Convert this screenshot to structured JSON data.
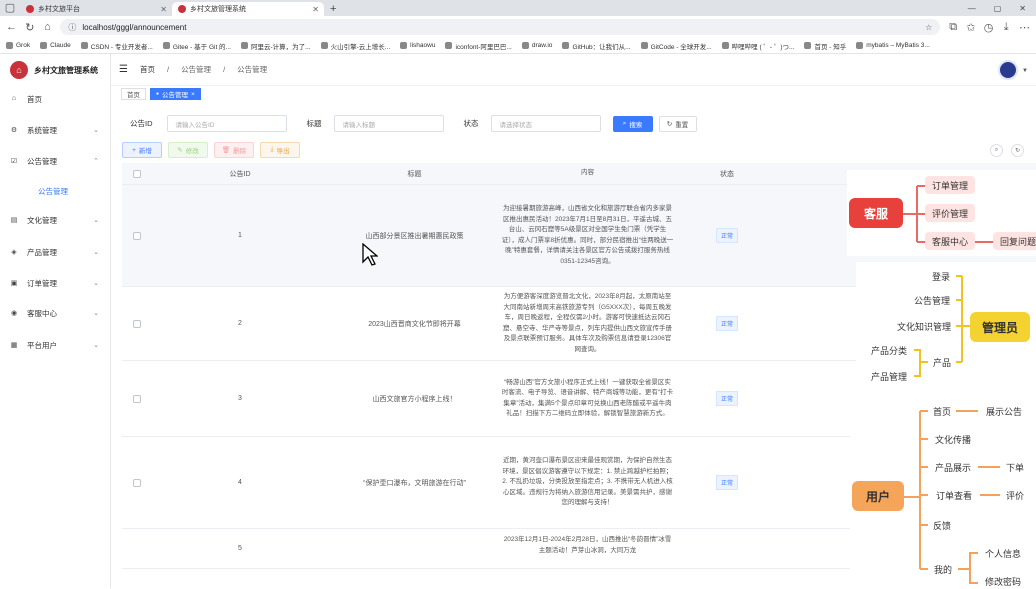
{
  "browser": {
    "tabs": [
      {
        "label": "乡村文旅平台",
        "active": false
      },
      {
        "label": "乡村文旅管理系统",
        "active": true
      }
    ],
    "url": "localhost/gggl/announcement",
    "bookmarks": [
      "Grok",
      "Claude",
      "CSDN - 专业开发者...",
      "Gitee - 基于 Git 的...",
      "阿里云-计算，为了...",
      "火山引擎-云上增长...",
      "lishaowu",
      "iconfont-阿里巴巴...",
      "draw.io",
      "GitHub：让我们从...",
      "GitCode - 全球开发...",
      "哔哩哔哩 ( ゜- ゜)つ...",
      "首页 - 知乎",
      "mybatis – MyBatis 3..."
    ]
  },
  "app": {
    "title": "乡村文旅管理系统",
    "menu": [
      {
        "label": "首页",
        "icon": "home-icon",
        "expandable": false
      },
      {
        "label": "系统管理",
        "icon": "gear-icon",
        "expandable": true
      },
      {
        "label": "公告管理",
        "icon": "checkbox-icon",
        "expandable": true
      },
      {
        "label": "公告管理",
        "sub": true
      },
      {
        "label": "文化管理",
        "icon": "book-icon",
        "expandable": true
      },
      {
        "label": "产品管理",
        "icon": "box-icon",
        "expandable": true
      },
      {
        "label": "订单管理",
        "icon": "cart-icon",
        "expandable": true
      },
      {
        "label": "客服中心",
        "icon": "headset-icon",
        "expandable": true
      },
      {
        "label": "平台用户",
        "icon": "user-icon",
        "expandable": true
      }
    ],
    "breadcrumb": [
      "首页",
      "公告管理",
      "公告管理"
    ],
    "tags": [
      {
        "label": "首页",
        "active": false
      },
      {
        "label": "公告管理",
        "active": true
      }
    ]
  },
  "filters": {
    "id_label": "公告ID",
    "id_placeholder": "请输入公告ID",
    "title_label": "标题",
    "title_placeholder": "请输入标题",
    "status_label": "状态",
    "status_placeholder": "请选择状态",
    "search": "搜索",
    "reset": "重置"
  },
  "actions": {
    "add": "新增",
    "edit": "修改",
    "delete": "删除",
    "export": "导出"
  },
  "table": {
    "headers": [
      "公告ID",
      "标题",
      "内容",
      "状态"
    ],
    "rows": [
      {
        "id": "1",
        "title": "山西部分景区推出暑期惠民政策",
        "content": "为迎接暑期旅游高峰，山西省文化和旅游厅联合省内多家景区推出惠民活动！2023年7月1日至8月31日，平遥古城、五台山、云冈石窟等5A级景区对全国学生免门票（凭学生证），成人门票享8折优惠。同时，部分民宿推出“住两晚送一晚”特惠套餐，详情请关注各景区官方公告或拨打服务热线0351-12345咨询。",
        "status": "正常"
      },
      {
        "id": "2",
        "title": "2023山西晋商文化节即将开幕",
        "content": "为方便游客深度游览晋北文化，2023年8月起，太原南站至大同南站新增周末高铁旅游专列（G5XXX次），每周五晚发车，周日晚返程，全程仅需2小时。游客可快速抵达云冈石窟、悬空寺、华严寺等景点，列车内提供山西文旅宣传手册及景点联票预订服务。具体车次及购票信息请登录12306官网查询。",
        "status": "正常"
      },
      {
        "id": "3",
        "title": "山西文旅官方小程序上线！",
        "content": "“畅游山西”官方文旅小程序正式上线！一键获取全省景区实时客流、电子导览、语音讲解、特产商城等功能，更有“打卡集章”活动，集满5个景点印章可兑换山西老陈醋或平遥牛肉礼品！扫描下方二维码立即体验，解锁智慧旅游新方式。",
        "status": "正常"
      },
      {
        "id": "4",
        "title": "“保护壶口瀑布，文明旅游在行动”",
        "content": "近期，黄河壶口瀑布景区迎来最佳观赏期，为保护自然生态环境，景区倡议游客遵守以下规定：1. 禁止跨越护栏拍照；2. 不乱扔垃圾，分类投放至指定点；3. 不携带无人机进入核心区域。违规行为将纳入旅游信用记录。美景需共护，感谢您的理解与支持！",
        "status": "正常"
      },
      {
        "id": "5",
        "title": "",
        "content": "2023年12月1日-2024年2月28日，山西推出“冬韵晋情”冰雪主题活动！芦芽山冰洞，大同万龙",
        "status": ""
      }
    ]
  },
  "diagrams": {
    "kefu": {
      "hub": "客服",
      "items": [
        "订单管理",
        "评价管理",
        "客服中心"
      ],
      "leaf": "回复问题"
    },
    "admin": {
      "hub": "管理员",
      "items": [
        "登录",
        "公告管理",
        "文化知识管理",
        "产品"
      ],
      "leaves": [
        "产品分类",
        "产品管理"
      ]
    },
    "user": {
      "hub": "用户",
      "items": [
        "首页",
        "文化传播",
        "产品展示",
        "订单查看",
        "反馈",
        "我的"
      ],
      "leaves": [
        "展示公告",
        "下单",
        "评价",
        "个人信息",
        "修改密码"
      ]
    }
  }
}
